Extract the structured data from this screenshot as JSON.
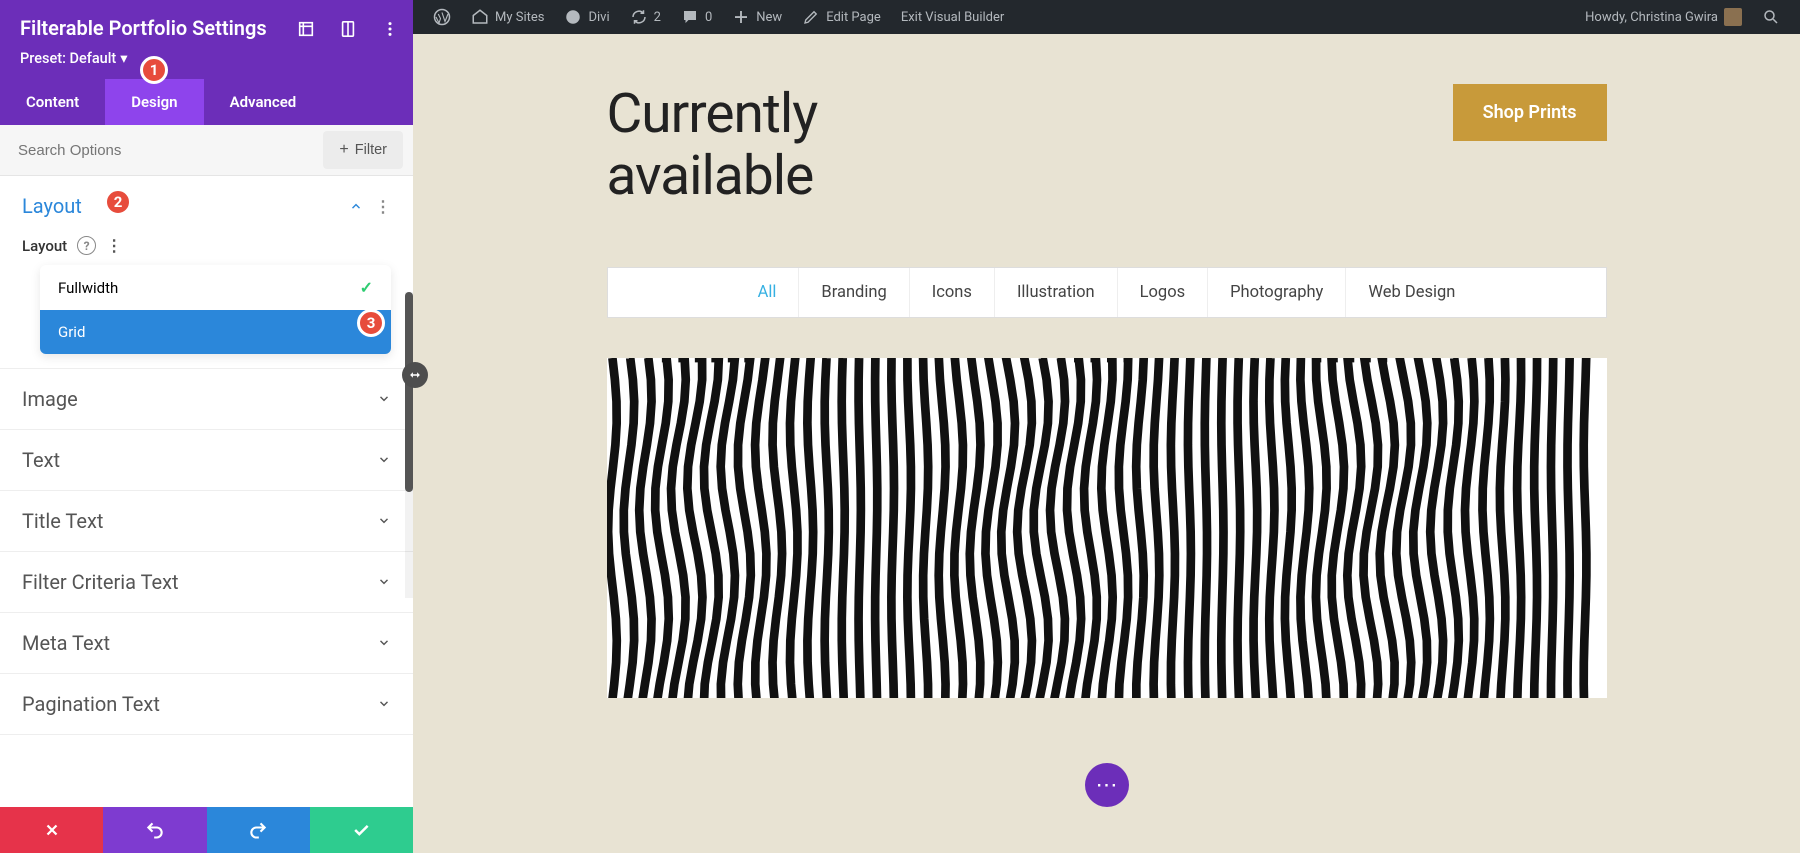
{
  "wp_bar": {
    "my_sites": "My Sites",
    "divi": "Divi",
    "updates": "2",
    "comments": "0",
    "new": "New",
    "edit_page": "Edit Page",
    "exit_builder": "Exit Visual Builder",
    "howdy": "Howdy, Christina Gwira"
  },
  "sidebar": {
    "title": "Filterable Portfolio Settings",
    "preset": "Preset: Default",
    "tabs": {
      "content": "Content",
      "design": "Design",
      "advanced": "Advanced"
    },
    "search_placeholder": "Search Options",
    "filter_btn": "Filter",
    "sections": {
      "layout": "Layout",
      "image": "Image",
      "text": "Text",
      "title_text": "Title Text",
      "filter_criteria_text": "Filter Criteria Text",
      "meta_text": "Meta Text",
      "pagination_text": "Pagination Text"
    },
    "layout_sub_label": "Layout",
    "layout_options": {
      "fullwidth": "Fullwidth",
      "grid": "Grid"
    }
  },
  "badges": {
    "b1": "1",
    "b2": "2",
    "b3": "3"
  },
  "preview": {
    "hero_line1": "Currently",
    "hero_line2": "available",
    "shop_btn": "Shop Prints",
    "filters": [
      "All",
      "Branding",
      "Icons",
      "Illustration",
      "Logos",
      "Photography",
      "Web Design"
    ]
  }
}
